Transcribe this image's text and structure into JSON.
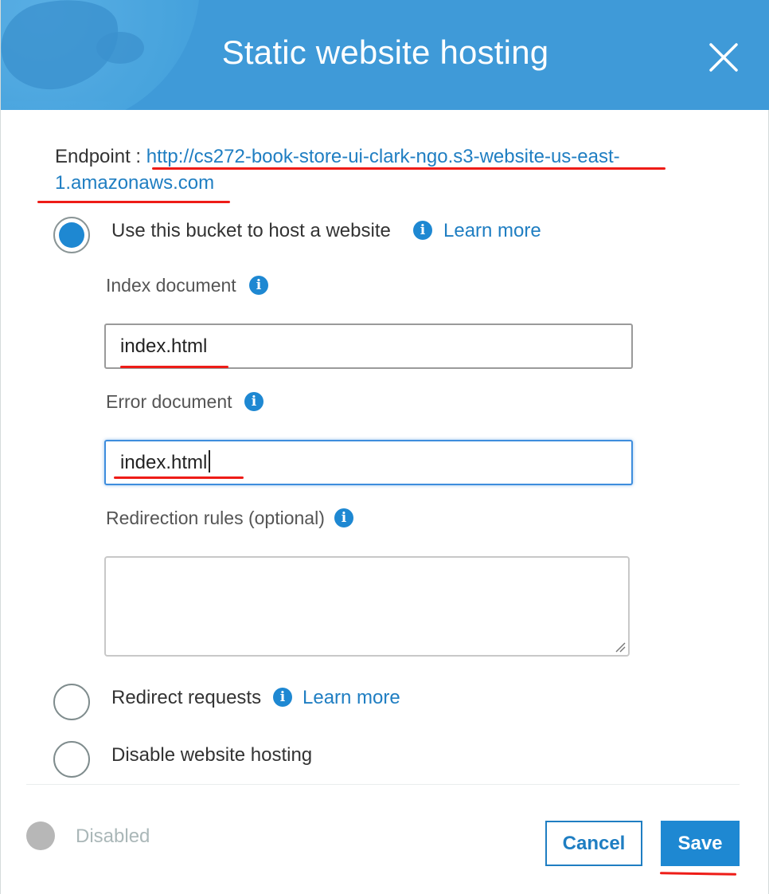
{
  "dialog": {
    "title": "Static website hosting",
    "close_label": "close"
  },
  "endpoint": {
    "label": "Endpoint : ",
    "url": "http://cs272-book-store-ui-clark-ngo.s3-website-us-east-1.amazonaws.com"
  },
  "options": {
    "host": {
      "label": "Use this bucket to host a website",
      "learn_more": "Learn more",
      "selected": true
    },
    "redirect": {
      "label": "Redirect requests",
      "learn_more": "Learn more",
      "selected": false
    },
    "disable": {
      "label": "Disable website hosting",
      "selected": false
    }
  },
  "fields": {
    "index_document": {
      "label": "Index document",
      "value": "index.html"
    },
    "error_document": {
      "label": "Error document",
      "value": "index.html"
    },
    "redirection_rules": {
      "label": "Redirection rules (optional)",
      "value": ""
    }
  },
  "footer": {
    "status_label": "Disabled",
    "cancel_label": "Cancel",
    "save_label": "Save"
  },
  "colors": {
    "header_bg": "#3f9ad8",
    "accent": "#1e88d2",
    "link": "#1f7ec2",
    "annotation_red": "#ee1c17"
  },
  "icons": {
    "close": "close-icon",
    "info": "info-icon",
    "globe": "globe-icon"
  }
}
